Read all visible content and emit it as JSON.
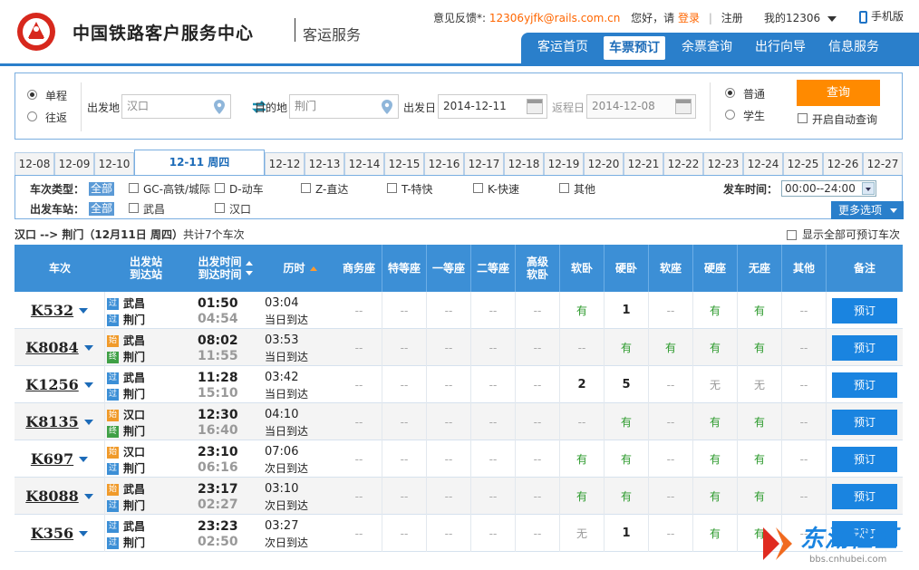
{
  "header": {
    "brand": "中国铁路客户服务中心",
    "sub": "客运服务",
    "feedback_label": "意见反馈",
    "feedback_email": "12306yjfk@rails.com.cn",
    "greeting": "您好，请",
    "login": "登录",
    "register": "注册",
    "my12306": "我的12306",
    "mobile": "手机版",
    "nav": [
      "客运首页",
      "车票预订",
      "余票查询",
      "出行向导",
      "信息服务"
    ]
  },
  "search": {
    "oneway": "单程",
    "roundtrip": "往返",
    "from_label": "出发地",
    "from_value": "汉口",
    "to_label": "目的地",
    "to_value": "荆门",
    "date_label": "出发日",
    "date_value": "2014-12-11",
    "return_label": "返程日",
    "return_value": "2014-12-08",
    "normal": "普通",
    "student": "学生",
    "query_btn": "查询",
    "auto_query": "开启自动查询"
  },
  "tabs": [
    "12-08",
    "12-09",
    "12-10",
    "12-11 周四",
    "12-12",
    "12-13",
    "12-14",
    "12-15",
    "12-16",
    "12-17",
    "12-18",
    "12-19",
    "12-20",
    "12-21",
    "12-22",
    "12-23",
    "12-24",
    "12-25",
    "12-26",
    "12-27"
  ],
  "filters": {
    "type_label": "车次类型：",
    "station_label": "出发车站：",
    "all": "全部",
    "types": [
      "GC-高铁/城际",
      "D-动车",
      "Z-直达",
      "T-特快",
      "K-快速",
      "其他"
    ],
    "stations": [
      "武昌",
      "汉口"
    ],
    "time_label": "发车时间：",
    "time_value": "00:00--24:00",
    "more": "更多选项"
  },
  "summary": {
    "route": "汉口 --> 荆门（12月11日 周四）",
    "count": "共计7个车次",
    "show_all": "显示全部可预订车次"
  },
  "table": {
    "headers": [
      "车次",
      "出发站\n到达站",
      "出发时间\n到达时间",
      "历时",
      "商务座",
      "特等座",
      "一等座",
      "二等座",
      "高级\n软卧",
      "软卧",
      "硬卧",
      "软座",
      "硬座",
      "无座",
      "其他",
      "备注"
    ],
    "book": "预订",
    "rows": [
      {
        "train": "K532",
        "from": "武昌",
        "from_tag": "过",
        "to": "荆门",
        "to_tag": "过",
        "dep": "01:50",
        "arr": "04:54",
        "dur": "03:04",
        "day": "当日到达",
        "seats": [
          "--",
          "--",
          "--",
          "--",
          "--",
          "有",
          "1",
          "--",
          "有",
          "有",
          "--"
        ]
      },
      {
        "train": "K8084",
        "from": "武昌",
        "from_tag": "始",
        "to": "荆门",
        "to_tag": "终",
        "dep": "08:02",
        "arr": "11:55",
        "dur": "03:53",
        "day": "当日到达",
        "seats": [
          "--",
          "--",
          "--",
          "--",
          "--",
          "--",
          "有",
          "有",
          "有",
          "有",
          "--"
        ]
      },
      {
        "train": "K1256",
        "from": "武昌",
        "from_tag": "过",
        "to": "荆门",
        "to_tag": "过",
        "dep": "11:28",
        "arr": "15:10",
        "dur": "03:42",
        "day": "当日到达",
        "seats": [
          "--",
          "--",
          "--",
          "--",
          "--",
          "2",
          "5",
          "--",
          "无",
          "无",
          "--"
        ]
      },
      {
        "train": "K8135",
        "from": "汉口",
        "from_tag": "始",
        "to": "荆门",
        "to_tag": "终",
        "dep": "12:30",
        "arr": "16:40",
        "dur": "04:10",
        "day": "当日到达",
        "seats": [
          "--",
          "--",
          "--",
          "--",
          "--",
          "--",
          "有",
          "--",
          "有",
          "有",
          "--"
        ]
      },
      {
        "train": "K697",
        "from": "汉口",
        "from_tag": "始",
        "to": "荆门",
        "to_tag": "过",
        "dep": "23:10",
        "arr": "06:16",
        "dur": "07:06",
        "day": "次日到达",
        "seats": [
          "--",
          "--",
          "--",
          "--",
          "--",
          "有",
          "有",
          "--",
          "有",
          "有",
          "--"
        ]
      },
      {
        "train": "K8088",
        "from": "武昌",
        "from_tag": "始",
        "to": "荆门",
        "to_tag": "过",
        "dep": "23:17",
        "arr": "02:27",
        "dur": "03:10",
        "day": "次日到达",
        "seats": [
          "--",
          "--",
          "--",
          "--",
          "--",
          "有",
          "有",
          "--",
          "有",
          "有",
          "--"
        ]
      },
      {
        "train": "K356",
        "from": "武昌",
        "from_tag": "过",
        "to": "荆门",
        "to_tag": "过",
        "dep": "23:23",
        "arr": "02:50",
        "dur": "03:27",
        "day": "次日到达",
        "seats": [
          "--",
          "--",
          "--",
          "--",
          "--",
          "无",
          "1",
          "--",
          "有",
          "有",
          "--"
        ]
      }
    ]
  },
  "watermark": {
    "text": "东湖社区",
    "url": "bbs.cnhubei.com"
  },
  "colors": {
    "primary": "#2a7fcb",
    "accent": "#ff8a00",
    "available": "#2c9a2c"
  }
}
